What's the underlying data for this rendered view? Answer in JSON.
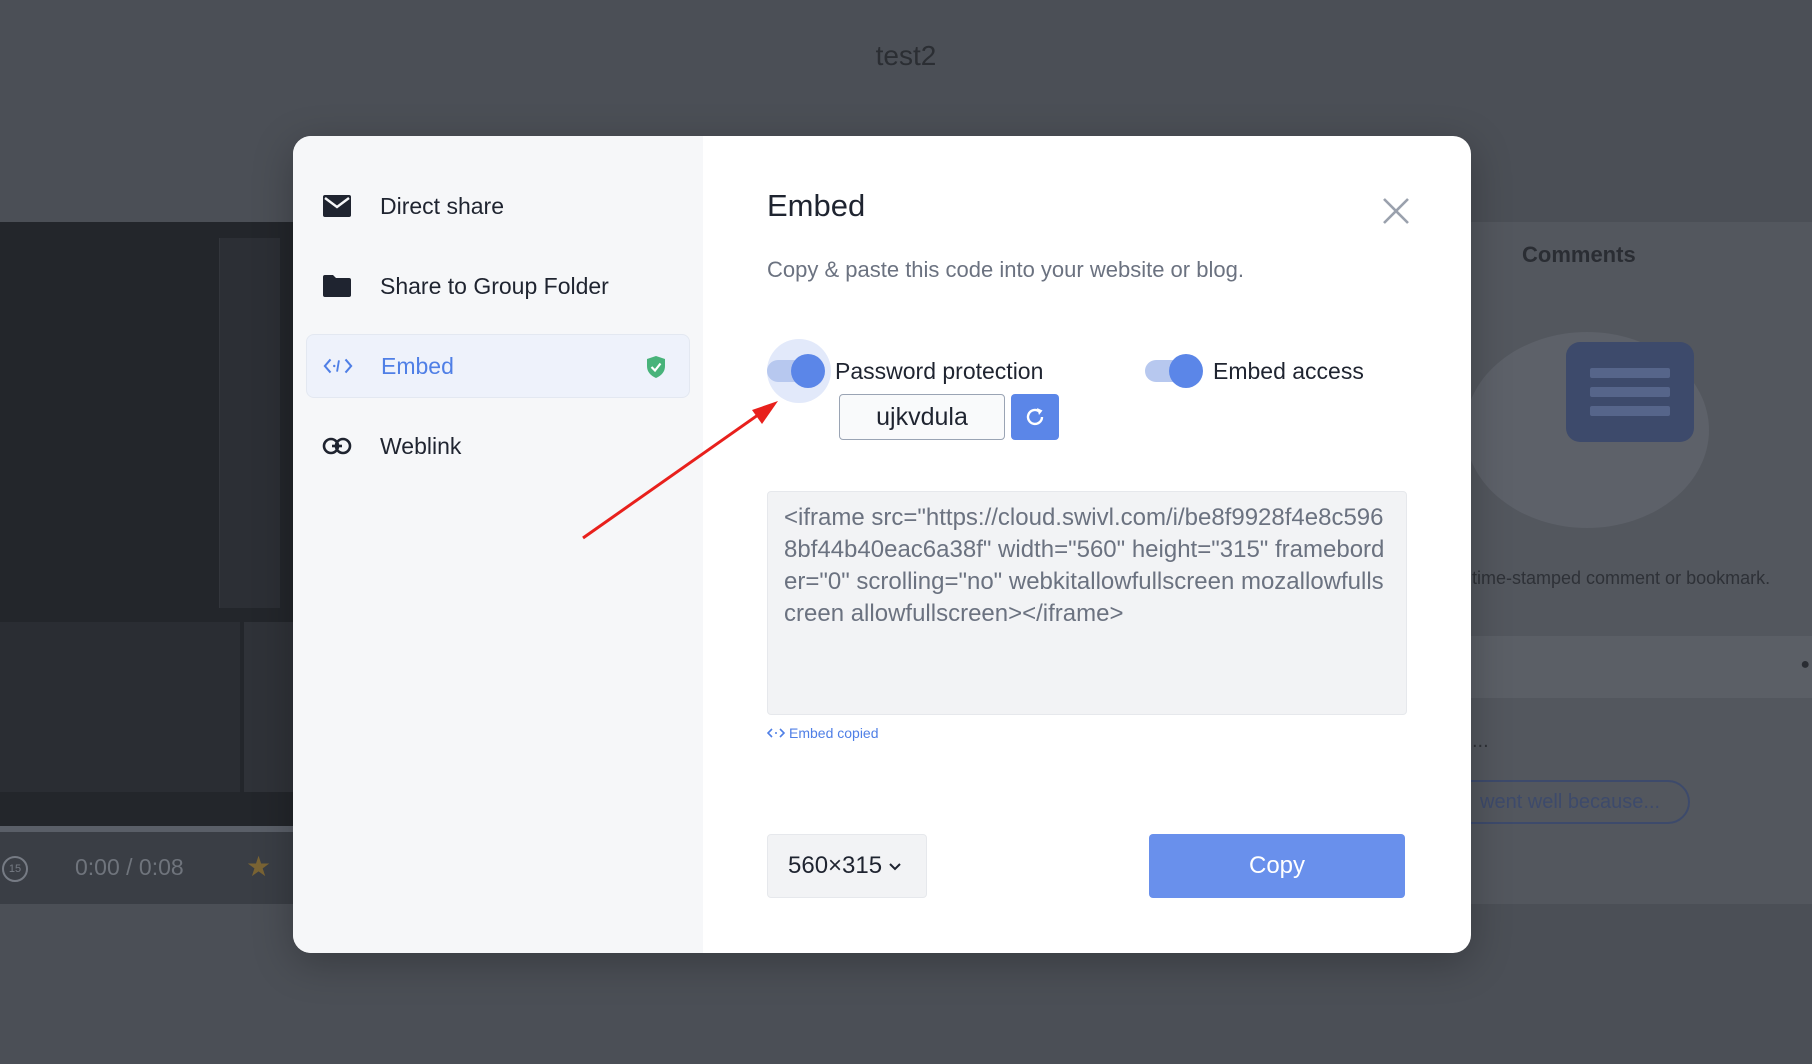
{
  "background": {
    "page_title": "test2",
    "player": {
      "time": "0:00 / 0:08",
      "rewind_label": "15"
    },
    "comments": {
      "title": "Comments",
      "hint": "time-stamped comment or bookmark.",
      "dots": "...",
      "chip": "went well because..."
    }
  },
  "sidebar": {
    "items": [
      {
        "label": "Direct share",
        "icon": "envelope-icon"
      },
      {
        "label": "Share to Group Folder",
        "icon": "folder-icon"
      },
      {
        "label": "Embed",
        "icon": "code-icon",
        "active": true
      },
      {
        "label": "Weblink",
        "icon": "link-icon"
      }
    ]
  },
  "embed": {
    "title": "Embed",
    "subtitle": "Copy & paste this code into your website or blog.",
    "password_protection": {
      "label": "Password protection",
      "enabled": true,
      "password": "ujkvdula"
    },
    "embed_access": {
      "label": "Embed access",
      "enabled": true
    },
    "code": "<iframe src=\"https://cloud.swivl.com/i/be8f9928f4e8c5968bf44b40eac6a38f\" width=\"560\" height=\"315\" frameborder=\"0\" scrolling=\"no\" webkitallowfullscreen mozallowfullscreen allowfullscreen></iframe>",
    "copied_status": "Embed copied",
    "size_select": "560×315",
    "copy_button": "Copy"
  },
  "colors": {
    "accent": "#5b86e8",
    "accent_text": "#4f7fe6",
    "overlay": "#4b4f56",
    "shield_green": "#48b37a",
    "annotation_arrow": "#e8201c"
  }
}
